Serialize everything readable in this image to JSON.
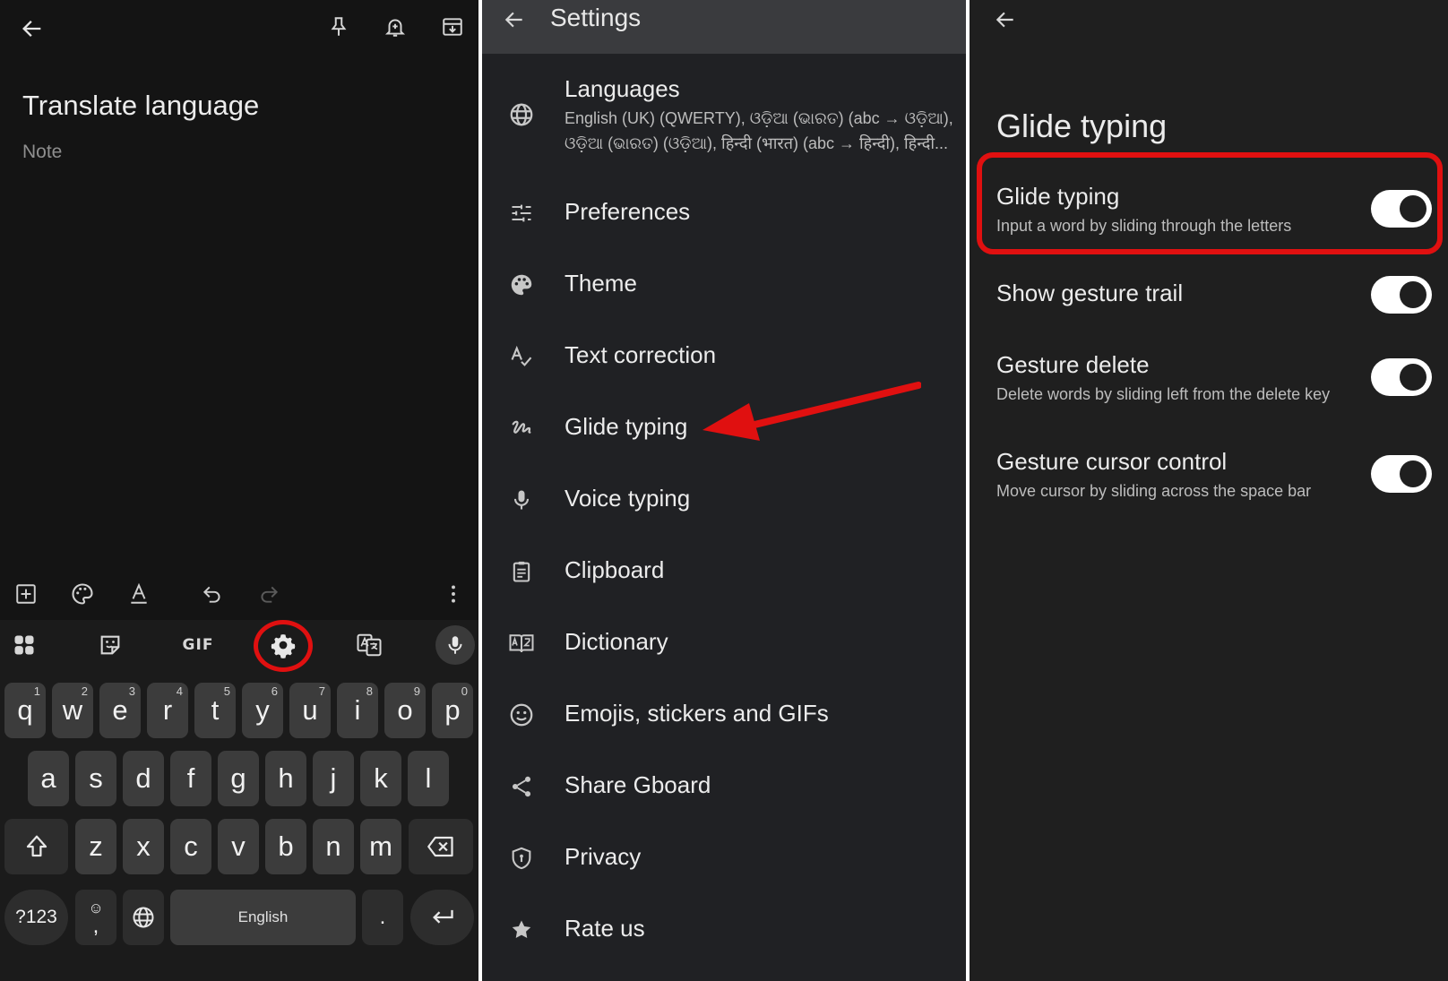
{
  "colors": {
    "highlight": "#e01010",
    "note_bg": "#141414",
    "settings_bg": "#202124",
    "settings_header_bg": "#3a3b3e",
    "glide_bg": "#1f1f1f",
    "toggle_on_track": "#ffffff"
  },
  "note": {
    "title": "Translate language",
    "placeholder": "Note",
    "top_icons": [
      "back-arrow-icon",
      "pin-icon",
      "reminder-bell-icon",
      "archive-icon"
    ],
    "bottom_icons": [
      "add-box-icon",
      "palette-icon",
      "text-format-icon",
      "undo-icon",
      "redo-icon",
      "more-vert-icon"
    ]
  },
  "keyboard": {
    "toolbar": {
      "gif_label": "GIF",
      "icons": [
        "apps-grid-icon",
        "sticker-icon",
        "gif-icon",
        "settings-gear-icon",
        "translate-icon",
        "mic-icon"
      ]
    },
    "row1": [
      {
        "key": "q",
        "hint": "1"
      },
      {
        "key": "w",
        "hint": "2"
      },
      {
        "key": "e",
        "hint": "3"
      },
      {
        "key": "r",
        "hint": "4"
      },
      {
        "key": "t",
        "hint": "5"
      },
      {
        "key": "y",
        "hint": "6"
      },
      {
        "key": "u",
        "hint": "7"
      },
      {
        "key": "i",
        "hint": "8"
      },
      {
        "key": "o",
        "hint": "9"
      },
      {
        "key": "p",
        "hint": "0"
      }
    ],
    "row2": [
      "a",
      "s",
      "d",
      "f",
      "g",
      "h",
      "j",
      "k",
      "l"
    ],
    "row3": [
      "z",
      "x",
      "c",
      "v",
      "b",
      "n",
      "m"
    ],
    "symbols_key": "?123",
    "emoji_key_top": "☺",
    "comma_key": ",",
    "space_label": "English",
    "period_key": ".",
    "shift_icon": "shift-icon",
    "backspace_icon": "backspace-icon",
    "enter_icon": "enter-icon",
    "globe_icon": "globe-icon"
  },
  "settings": {
    "title": "Settings",
    "languages": {
      "label": "Languages",
      "line1": "English (UK) (QWERTY), ଓଡ଼ିଆ (ଭାରତ) (abc → ଓଡ଼ିଆ),",
      "line2": "ଓଡ଼ିଆ (ଭାରତ) (ଓଡ଼ିଆ), हिन्दी (भारत) (abc → हिन्दी), हिन्दी..."
    },
    "items": [
      {
        "label": "Preferences",
        "icon": "tune-icon"
      },
      {
        "label": "Theme",
        "icon": "palette-icon"
      },
      {
        "label": "Text correction",
        "icon": "spellcheck-icon"
      },
      {
        "label": "Glide typing",
        "icon": "gesture-icon"
      },
      {
        "label": "Voice typing",
        "icon": "mic-icon"
      },
      {
        "label": "Clipboard",
        "icon": "clipboard-icon"
      },
      {
        "label": "Dictionary",
        "icon": "dictionary-icon"
      },
      {
        "label": "Emojis, stickers and GIFs",
        "icon": "emoji-icon"
      },
      {
        "label": "Share Gboard",
        "icon": "share-icon"
      },
      {
        "label": "Privacy",
        "icon": "shield-icon"
      },
      {
        "label": "Rate us",
        "icon": "star-icon"
      }
    ]
  },
  "glide": {
    "title": "Glide typing",
    "rows": [
      {
        "title": "Glide typing",
        "desc": "Input a word by sliding through the letters",
        "on": true
      },
      {
        "title": "Show gesture trail",
        "desc": "",
        "on": true
      },
      {
        "title": "Gesture delete",
        "desc": "Delete words by sliding left from the delete key",
        "on": true
      },
      {
        "title": "Gesture cursor control",
        "desc": "Move cursor by sliding across the space bar",
        "on": true
      }
    ]
  }
}
